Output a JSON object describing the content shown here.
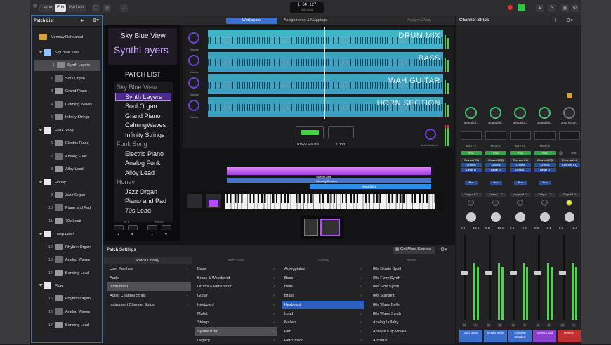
{
  "topbar": {
    "modes": [
      "Layout",
      "Edit",
      "Perform"
    ],
    "lcd": {
      "bar": "1",
      "beat": "64",
      "tempo": "127",
      "sub": "4/4  C maj"
    }
  },
  "patch_list": {
    "title": "Patch List",
    "groups": [
      {
        "name": "Monday Rehearsal"
      },
      {
        "name": "Sky Blue View",
        "items": [
          {
            "num": "1",
            "name": "Synth Layers"
          },
          {
            "num": "2",
            "name": "Soul Organ"
          },
          {
            "num": "3",
            "name": "Grand Piano"
          },
          {
            "num": "4",
            "name": "Calming Waves"
          },
          {
            "num": "5",
            "name": "Infinity Strings"
          }
        ]
      },
      {
        "name": "Funk Song",
        "items": [
          {
            "num": "6",
            "name": "Electric Piano"
          },
          {
            "num": "7",
            "name": "Analog Funk"
          },
          {
            "num": "8",
            "name": "Alloy Lead"
          }
        ]
      },
      {
        "name": "Honey",
        "items": [
          {
            "num": "9",
            "name": "Jazz Organ"
          },
          {
            "num": "10",
            "name": "Piano and Pad"
          },
          {
            "num": "11",
            "name": "70s Lead"
          }
        ]
      },
      {
        "name": "Deep Feels",
        "items": [
          {
            "num": "12",
            "name": "Rhythm Organ"
          },
          {
            "num": "13",
            "name": "Analog Waves"
          },
          {
            "num": "14",
            "name": "Bending Lead"
          }
        ]
      },
      {
        "name": "Flow",
        "items": [
          {
            "num": "15",
            "name": "Rhythm Organ"
          },
          {
            "num": "16",
            "name": "Analog Waves"
          },
          {
            "num": "17",
            "name": "Bending Lead"
          }
        ]
      }
    ]
  },
  "workspace": {
    "tabs": [
      "Workspace",
      "Assignments & Mappings"
    ],
    "assign_map": "Assign & Map",
    "concert": "Sky Blue View",
    "patch": "SynthLayers",
    "patch_list_title": "PATCH LIST",
    "list": [
      {
        "t": "Sky Blue View",
        "h": true
      },
      {
        "t": "Synth Layers",
        "sel": true
      },
      {
        "t": "Soul Organ"
      },
      {
        "t": "Grand Piano"
      },
      {
        "t": "CalmngWaves"
      },
      {
        "t": "Infinity Strings"
      },
      {
        "t": "Funk Song",
        "h": true
      },
      {
        "t": "Electric Piano"
      },
      {
        "t": "Analog Funk"
      },
      {
        "t": "Alloy Lead"
      },
      {
        "t": "Honey",
        "h": true
      },
      {
        "t": "Jazz Organ"
      },
      {
        "t": "Piano and Pad"
      },
      {
        "t": "70s Lead"
      }
    ],
    "set_label": "SET",
    "patch_label": "PATCH",
    "tracks": [
      "DRUM MIX",
      "BASS",
      "WAH GUITAR",
      "HORN SECTION"
    ],
    "volume_label": "Volume",
    "play_pause": "Play / Pause",
    "loop": "Loop",
    "main_volume": "Main Volume",
    "layers": [
      "Sweet Lead",
      "Glowing Shadow",
      "Bright Bells"
    ]
  },
  "settings": {
    "title": "Patch Settings",
    "get_more": "Get More Sounds",
    "tabs": [
      "Patch Library",
      "Attributes",
      "Tuning",
      "Notes"
    ],
    "col1": [
      "User Patches",
      "Audio",
      "Instrument",
      "Audio Channel Strips",
      "Instrument Channel Strips"
    ],
    "col1_sel": 2,
    "col2": [
      "Bass",
      "Brass & Woodwind",
      "Drums & Percussion",
      "Guitar",
      "Keyboard",
      "Mallet",
      "Strings",
      "Synthesizer",
      "Legacy"
    ],
    "col2_sel": 7,
    "col3": [
      "Arpeggiated",
      "Bass",
      "Bells",
      "Brass",
      "Keyboard",
      "Lead",
      "Mallets",
      "Pad",
      "Percussion"
    ],
    "col3_sel": 4,
    "col4": [
      "80s Bitrate Synth",
      "80s Fizzy Synth",
      "80s Sine Synth",
      "80s Starlight",
      "80s Wave Bells",
      "80s Wave Synth",
      "Analog Lullaby",
      "Antique Key Moves",
      "Arcturus"
    ]
  },
  "mixer": {
    "title": "Channel Strips",
    "strips": [
      {
        "preset": "Beautiful...",
        "eq": "Channel EQ",
        "fx1": "Chorus",
        "fx2": "Delay D",
        "out": "Output 1-2",
        "v1": "0.0",
        "v2": "-13.5",
        "name": "Sub Bass",
        "color": "#3a6fd0"
      },
      {
        "preset": "Beautiful...",
        "eq": "Channel EQ",
        "fx1": "Chorus",
        "fx2": "Delay D",
        "out": "Output 1-2",
        "v1": "0.0",
        "v2": "-10.1",
        "name": "Bright Bells",
        "color": "#3a6fd0"
      },
      {
        "preset": "Beautiful...",
        "eq": "Channel EQ",
        "fx1": "Chorus",
        "fx2": "Delay D",
        "out": "Output 1-2",
        "v1": "0.0",
        "v2": "-9.4",
        "name": "Glowing Shadow",
        "color": "#3a6fd0"
      },
      {
        "preset": "Beautiful...",
        "eq": "Channel EQ",
        "fx1": "Chorus",
        "fx2": "Delay D",
        "out": "Output 1-2",
        "v1": "0.0",
        "v2": "-8.1",
        "name": "Sweet Lead",
        "color": "#8a3fd0"
      },
      {
        "preset": "2.6s Vocal...",
        "eq": "ChromaVerb",
        "fx1": "Channel EQ",
        "fx2": "",
        "out": "Output 1-2",
        "v1": "0.0",
        "v2": "-10.6",
        "name": "Reverb",
        "color": "#c03030"
      }
    ],
    "midi_fx": "MIDI FX",
    "es2": "ES2",
    "bus": "Bus",
    "mute": "M",
    "solo": "S"
  }
}
